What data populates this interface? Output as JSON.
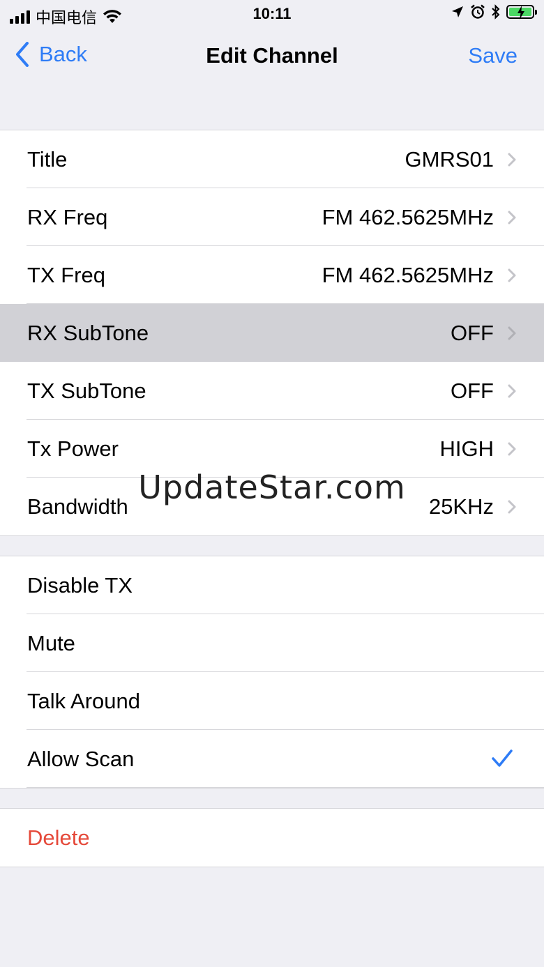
{
  "status_bar": {
    "carrier": "中国电信",
    "time": "10:11",
    "battery_color": "#4cd964"
  },
  "nav": {
    "back_label": "Back",
    "title": "Edit Channel",
    "save_label": "Save",
    "accent_color": "#2e7cf6"
  },
  "settings": [
    {
      "label": "Title",
      "value": "GMRS01"
    },
    {
      "label": "RX Freq",
      "value": "FM 462.5625MHz"
    },
    {
      "label": "TX Freq",
      "value": "FM 462.5625MHz"
    },
    {
      "label": "RX SubTone",
      "value": "OFF"
    },
    {
      "label": "TX SubTone",
      "value": "OFF"
    },
    {
      "label": "Tx Power",
      "value": "HIGH"
    },
    {
      "label": "Bandwidth",
      "value": "25KHz"
    }
  ],
  "options": [
    {
      "label": "Disable TX",
      "checked": false
    },
    {
      "label": "Mute",
      "checked": false
    },
    {
      "label": "Talk Around",
      "checked": false
    },
    {
      "label": "Allow Scan",
      "checked": true
    }
  ],
  "delete_label": "Delete",
  "watermark": "UpdateStar.com"
}
